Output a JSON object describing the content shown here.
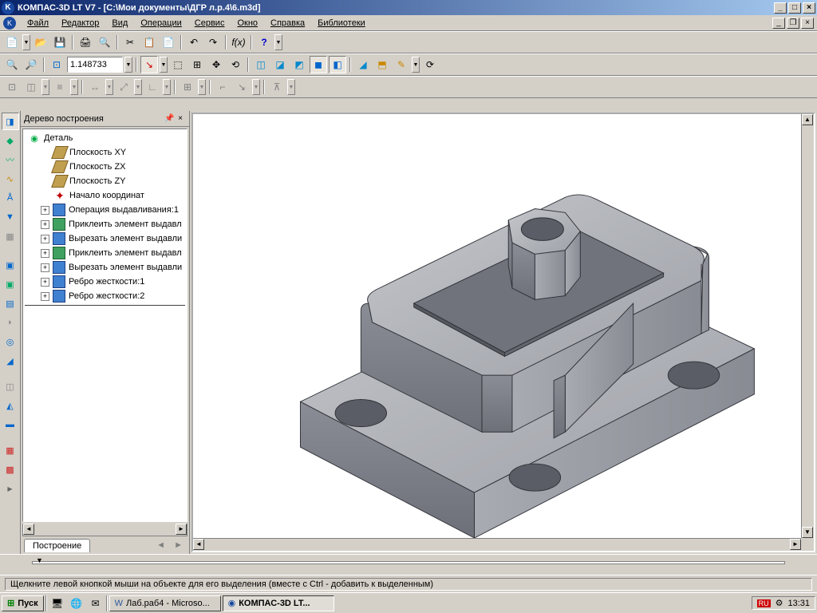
{
  "title": "КОМПАС-3D LT V7 - [C:\\Мои документы\\ДГР л.р.4\\6.m3d]",
  "menu": [
    "Файл",
    "Редактор",
    "Вид",
    "Операции",
    "Сервис",
    "Окно",
    "Справка",
    "Библиотеки"
  ],
  "zoom_value": "1.148733",
  "tree": {
    "title": "Дерево построения",
    "root": "Деталь",
    "planes": [
      "Плоскость XY",
      "Плоскость ZX",
      "Плоскость ZY"
    ],
    "origin": "Начало координат",
    "ops": [
      "Операция выдавливания:1",
      "Приклеить элемент выдавл",
      "Вырезать элемент выдавли",
      "Приклеить элемент выдавл",
      "Вырезать элемент выдавли",
      "Ребро жесткости:1",
      "Ребро жесткости:2"
    ],
    "tab": "Построение"
  },
  "status": "Щелкните левой кнопкой мыши на объекте для его выделения (вместе с Ctrl - добавить к выделенным)",
  "taskbar": {
    "start": "Пуск",
    "items": [
      "Лаб.раб4 - Microso...",
      "КОМПАС-3D LT..."
    ],
    "lang": "RU",
    "clock": "13:31"
  }
}
